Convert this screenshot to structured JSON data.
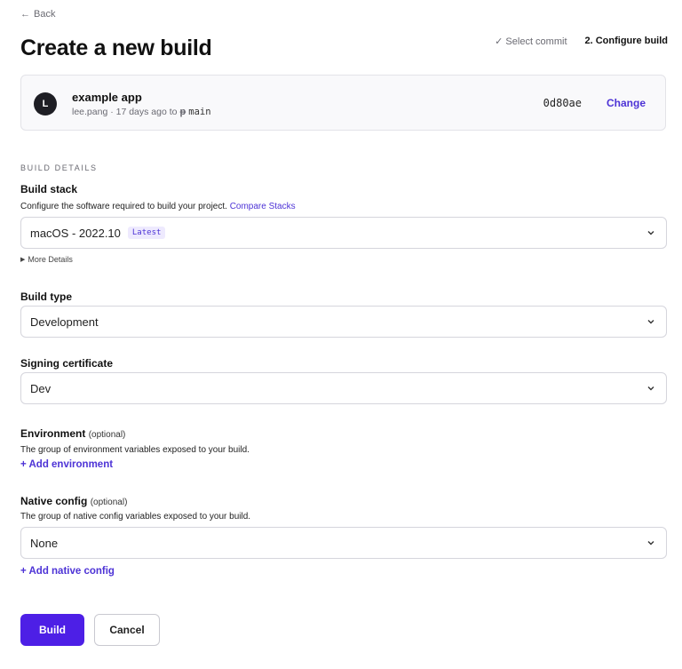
{
  "nav": {
    "back_label": "Back"
  },
  "page": {
    "title": "Create a new build"
  },
  "steps": [
    {
      "label": "Select commit",
      "state": "done"
    },
    {
      "label": "2. Configure build",
      "state": "current"
    }
  ],
  "commit": {
    "avatar_initial": "L",
    "app_name": "example app",
    "meta": "lee.pang · 17 days ago to",
    "branch": "main",
    "sha": "0d80ae",
    "change_label": "Change"
  },
  "build_details": {
    "section_label": "BUILD DETAILS",
    "build_stack": {
      "label": "Build stack",
      "helper": "Configure the software required to build your project.",
      "helper_link": "Compare Stacks",
      "value": "macOS - 2022.10",
      "badge": "Latest",
      "more_details": "More Details"
    },
    "build_type": {
      "label": "Build type",
      "value": "Development"
    },
    "signing": {
      "label": "Signing certificate",
      "value": "Dev"
    },
    "environment": {
      "label": "Environment",
      "optional": "(optional)",
      "helper": "The group of environment variables exposed to your build.",
      "add_label": "+ Add environment"
    },
    "native_config": {
      "label": "Native config",
      "optional": "(optional)",
      "helper": "The group of native config variables exposed to your build.",
      "value": "None",
      "add_label": "+ Add native config"
    }
  },
  "actions": {
    "build_label": "Build",
    "cancel_label": "Cancel"
  },
  "colors": {
    "accent": "#4d33d6",
    "primary_button": "#4d1fe6"
  }
}
